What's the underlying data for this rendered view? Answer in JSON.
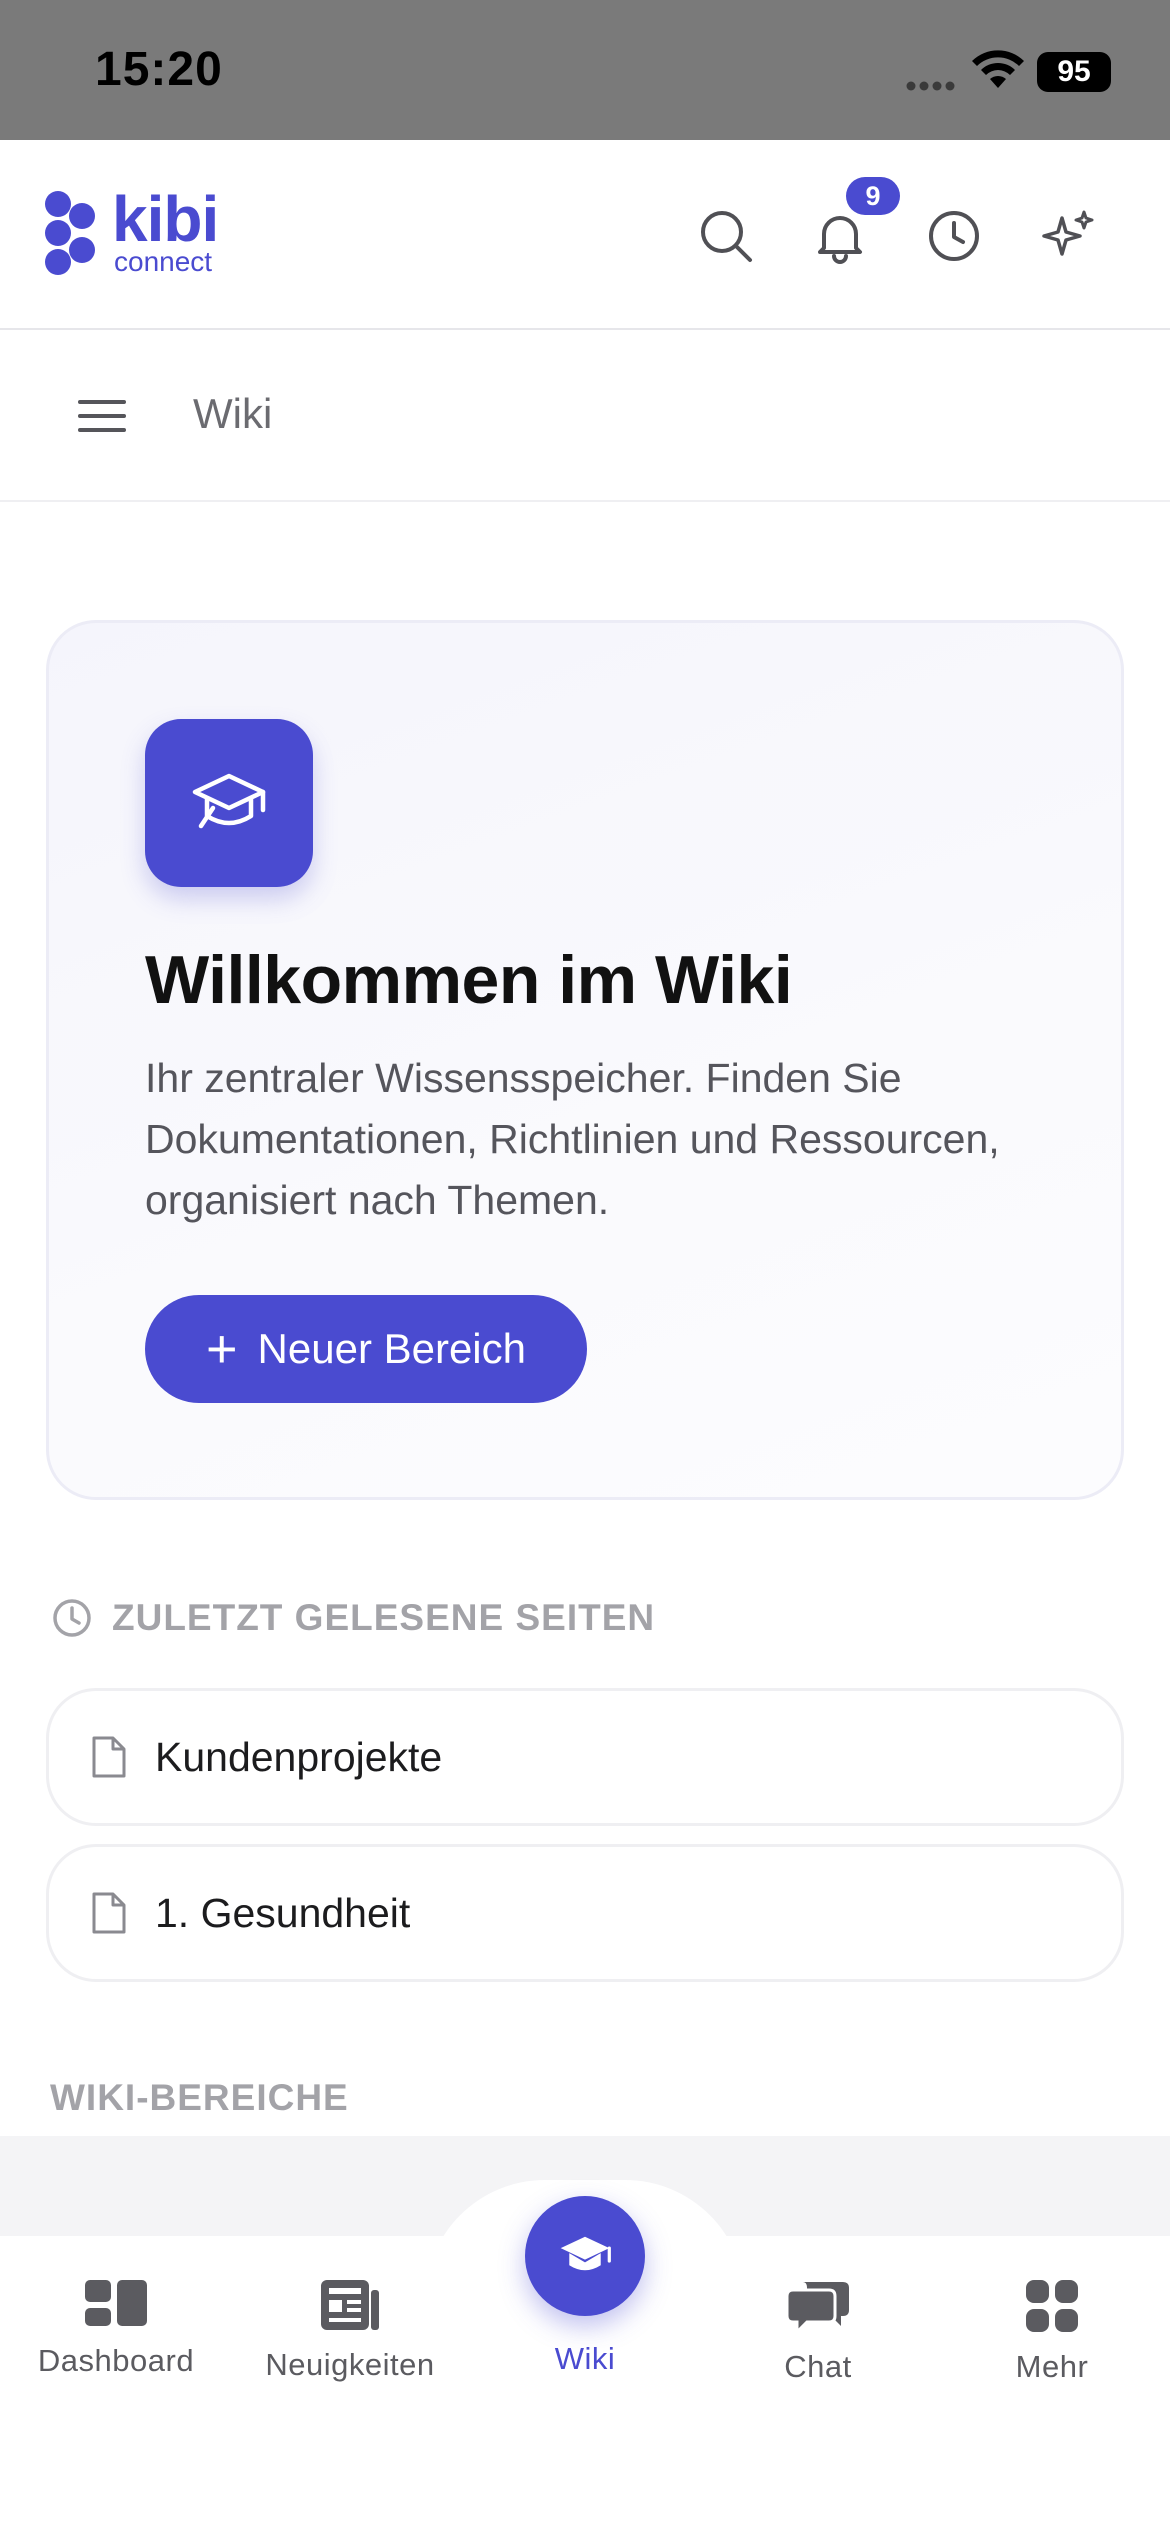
{
  "status_bar": {
    "time": "15:20",
    "battery": "95"
  },
  "header": {
    "logo_main": "kibi",
    "logo_sub": "connect",
    "notification_count": "9",
    "icons": [
      "search-icon",
      "bell-icon",
      "clock-icon",
      "sparkles-icon"
    ]
  },
  "breadcrumb": {
    "current": "Wiki"
  },
  "welcome": {
    "icon": "graduation-cap-icon",
    "title": "Willkommen im Wiki",
    "description": "Ihr zentraler Wissensspeicher. Finden Sie Dokumentationen, Richtlinien und Ressourcen, organisiert nach Themen.",
    "button_label": "Neuer Bereich"
  },
  "recent": {
    "heading": "ZULETZT GELESENE SEITEN",
    "items": [
      {
        "label": "Kundenprojekte"
      },
      {
        "label": "1. Gesundheit"
      }
    ]
  },
  "areas": {
    "heading": "WIKI-BEREICHE"
  },
  "tab_bar": {
    "tabs": [
      {
        "label": "Dashboard",
        "icon": "dashboard-icon"
      },
      {
        "label": "Neuigkeiten",
        "icon": "newspaper-icon"
      },
      {
        "label": "Wiki",
        "icon": "graduation-cap-icon",
        "active": true
      },
      {
        "label": "Chat",
        "icon": "chat-icon"
      },
      {
        "label": "Mehr",
        "icon": "grid-icon"
      }
    ]
  },
  "colors": {
    "accent": "#4a4bd0",
    "muted_heading": "#a3a3a8"
  }
}
